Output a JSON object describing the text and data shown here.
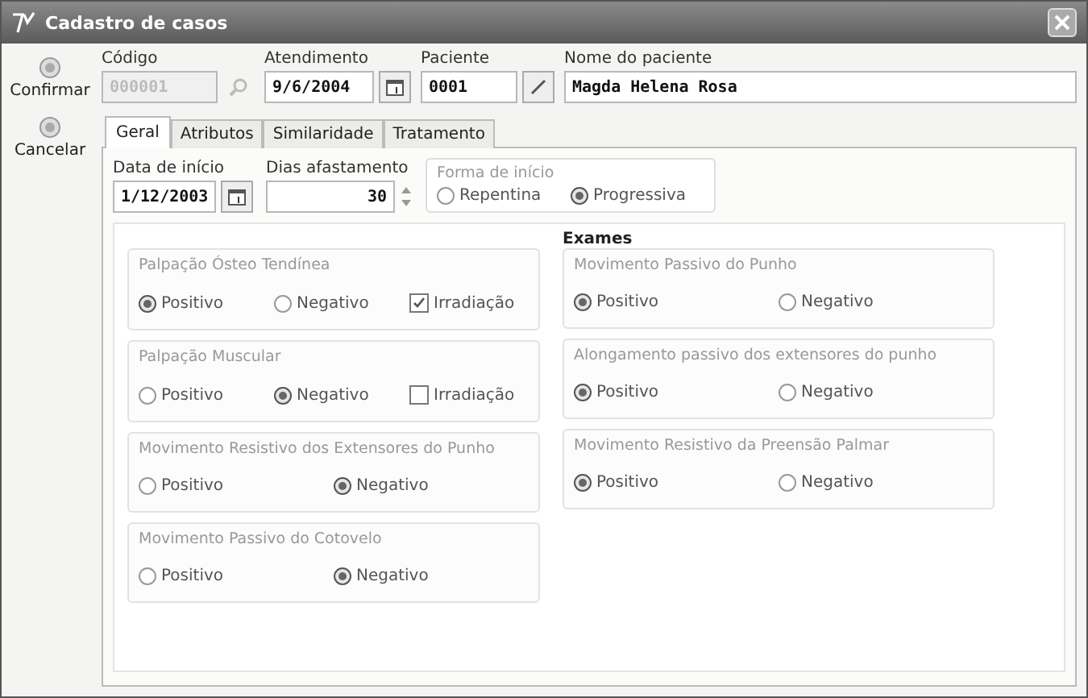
{
  "window": {
    "title": "Cadastro de casos"
  },
  "toolbar": [
    {
      "label": "Confirmar"
    },
    {
      "label": "Cancelar"
    }
  ],
  "header_fields": [
    {
      "label": "Código",
      "value": "000001",
      "disabled": true,
      "kind": "search"
    },
    {
      "label": "Atendimento",
      "value": "9/6/2004",
      "disabled": false,
      "kind": "calendar"
    },
    {
      "label": "Paciente",
      "value": "0001",
      "disabled": false,
      "kind": "lookup"
    },
    {
      "label": "Nome do paciente",
      "value": "Magda Helena Rosa",
      "disabled": false,
      "kind": "plain"
    }
  ],
  "tabs": [
    {
      "label": "Geral",
      "selected": true
    },
    {
      "label": "Atributos",
      "selected": false
    },
    {
      "label": "Similaridade",
      "selected": false
    },
    {
      "label": "Tratamento",
      "selected": false
    }
  ],
  "start_date": {
    "label": "Data de início",
    "value": "1/12/2003"
  },
  "days_off": {
    "label": "Dias afastamento",
    "value": "30"
  },
  "onset": {
    "title": "Forma de início",
    "options": [
      {
        "label": "Repentina",
        "selected": false
      },
      {
        "label": "Progressiva",
        "selected": true
      }
    ]
  },
  "exams": {
    "title": "Exames",
    "left": [
      {
        "title": "Palpação Ósteo Tendínea",
        "options": [
          {
            "label": "Positivo",
            "selected": true
          },
          {
            "label": "Negativo",
            "selected": false
          }
        ],
        "checkbox": {
          "label": "Irradiação",
          "checked": true
        }
      },
      {
        "title": "Palpação Muscular",
        "options": [
          {
            "label": "Positivo",
            "selected": false
          },
          {
            "label": "Negativo",
            "selected": true
          }
        ],
        "checkbox": {
          "label": "Irradiação",
          "checked": false
        }
      },
      {
        "title": "Movimento Resistivo dos Extensores do Punho",
        "options": [
          {
            "label": "Positivo",
            "selected": false
          },
          {
            "label": "Negativo",
            "selected": true
          }
        ]
      },
      {
        "title": "Movimento Passivo do Cotovelo",
        "options": [
          {
            "label": "Positivo",
            "selected": false
          },
          {
            "label": "Negativo",
            "selected": true
          }
        ]
      }
    ],
    "right": [
      {
        "title": "Movimento Passivo do Punho",
        "options": [
          {
            "label": "Positivo",
            "selected": true
          },
          {
            "label": "Negativo",
            "selected": false
          }
        ]
      },
      {
        "title": "Alongamento passivo dos extensores do punho",
        "options": [
          {
            "label": "Positivo",
            "selected": true
          },
          {
            "label": "Negativo",
            "selected": false
          }
        ]
      },
      {
        "title": "Movimento Resistivo da Preensão Palmar",
        "options": [
          {
            "label": "Positivo",
            "selected": true
          },
          {
            "label": "Negativo",
            "selected": false
          }
        ]
      }
    ]
  }
}
